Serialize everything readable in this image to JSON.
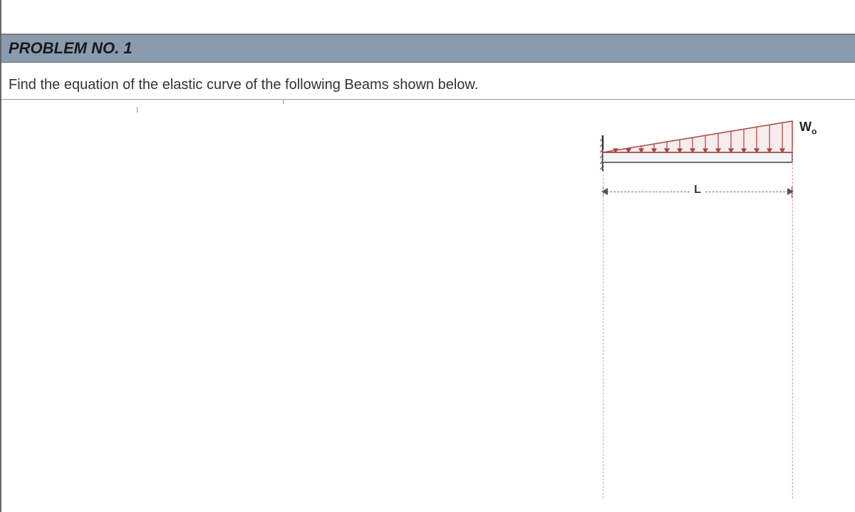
{
  "header": {
    "title": "PROBLEM NO. 1"
  },
  "problem": {
    "statement": "Find the equation of the elastic curve of the following Beams shown below."
  },
  "diagram": {
    "load_symbol": "W",
    "load_subscript": "o",
    "span_label": "L",
    "beam": {
      "type": "cantilever",
      "support": "fixed-left",
      "load": "triangular-increasing-right",
      "length_symbol": "L",
      "max_load_symbol": "Wo"
    }
  }
}
